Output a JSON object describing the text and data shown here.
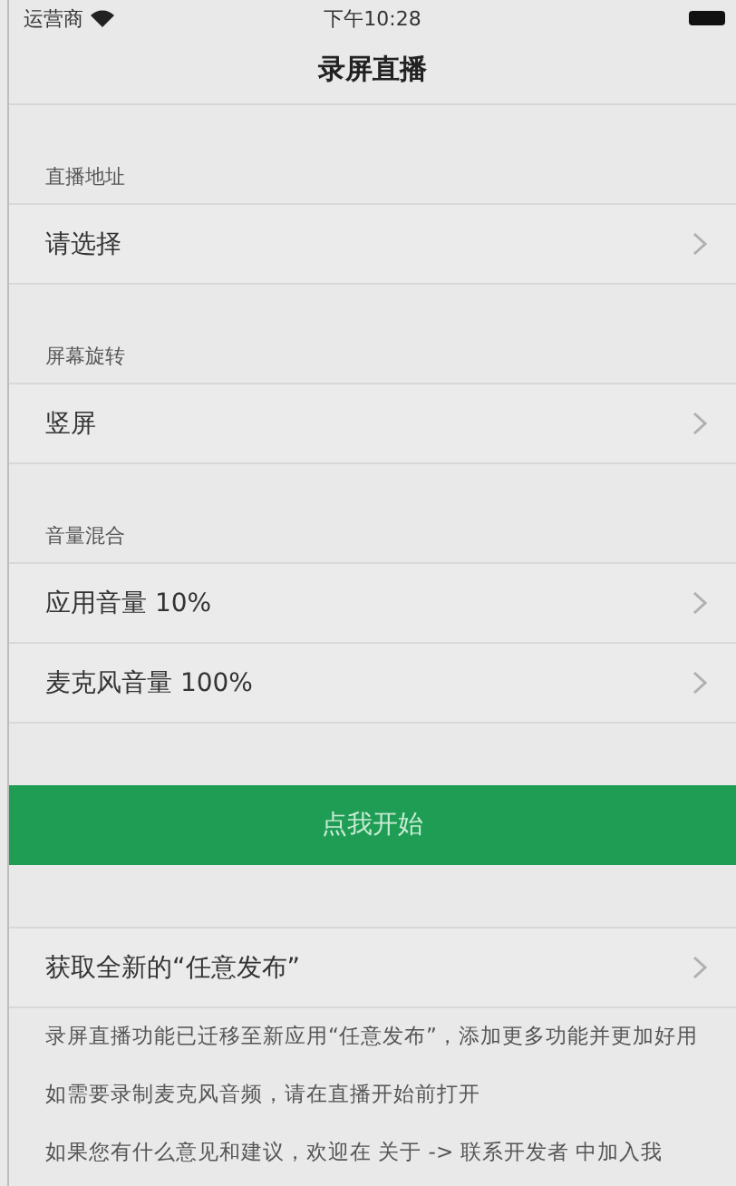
{
  "status_bar": {
    "carrier": "运营商",
    "time": "下午10:28"
  },
  "nav": {
    "title": "录屏直播"
  },
  "sections": [
    {
      "header": "直播地址",
      "rows": [
        {
          "label": "请选择"
        }
      ]
    },
    {
      "header": "屏幕旋转",
      "rows": [
        {
          "label": "竖屏"
        }
      ]
    },
    {
      "header": "音量混合",
      "rows": [
        {
          "label": "应用音量 10%"
        },
        {
          "label": "麦克风音量 100%"
        }
      ]
    }
  ],
  "start_button": "点我开始",
  "promo_row": "获取全新的“任意发布”",
  "notes": [
    "录屏直播功能已迁移至新应用“任意发布”，添加更多功能并更加好用",
    "如需要录制麦克风音频，请在直播开始前打开",
    "如果您有什么意见和建议，欢迎在 关于 -> 联系开发者 中加入我"
  ]
}
